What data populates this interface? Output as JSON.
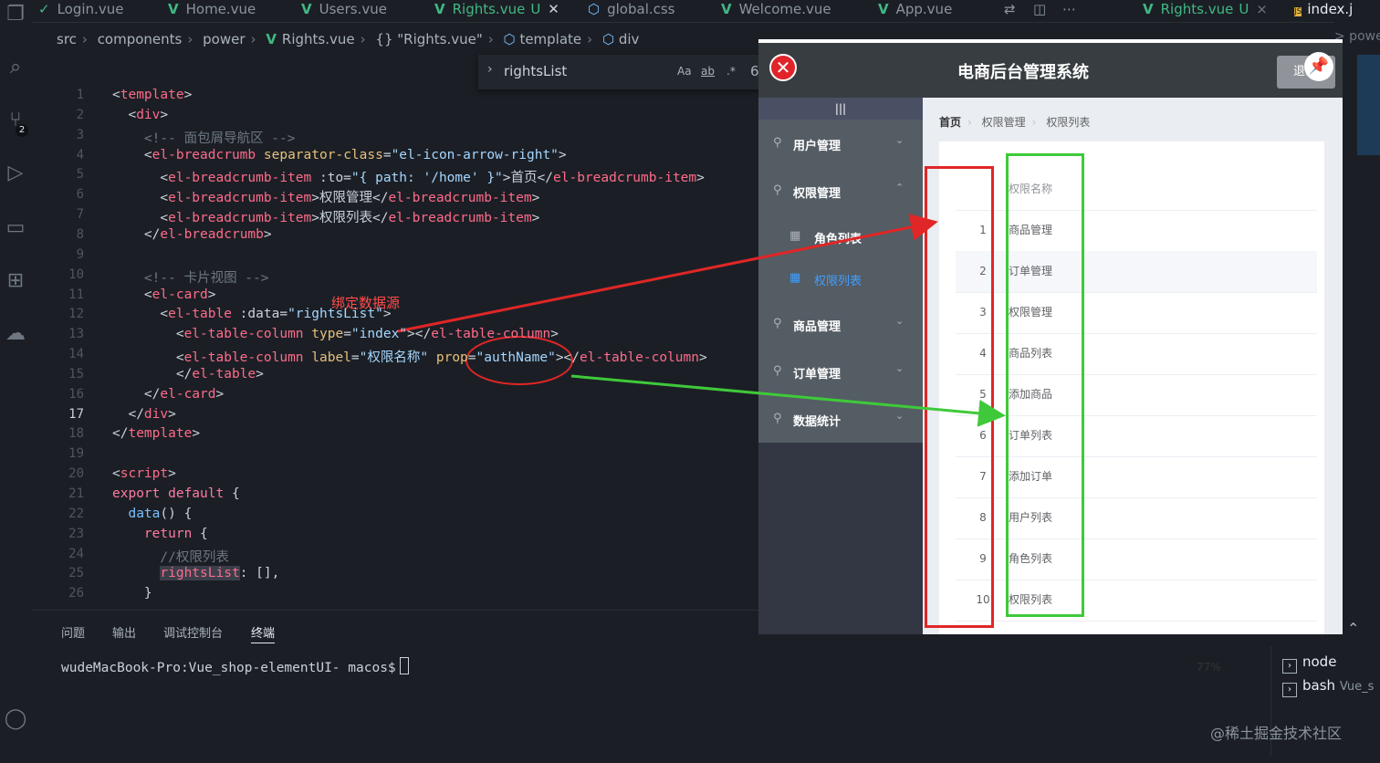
{
  "tabs": [
    {
      "label": "Login.vue",
      "active": false
    },
    {
      "label": "Home.vue",
      "active": false
    },
    {
      "label": "Users.vue",
      "active": false
    },
    {
      "label": "Rights.vue",
      "status": "U",
      "active": true
    },
    {
      "label": "global.css",
      "active": false
    },
    {
      "label": "Welcome.vue",
      "active": false
    },
    {
      "label": "App.vue",
      "active": false
    }
  ],
  "right_tabs": [
    {
      "label": "Rights.vue",
      "status": "U"
    },
    {
      "label": "index.j"
    }
  ],
  "right_edge_text": ">  power  >  Rights.vue  >  {} \"Rights.vu",
  "right_tab_icons": {
    "index_badge": "JS",
    "close": "×"
  },
  "breadcrumb": [
    "src",
    "components",
    "power",
    "Rights.vue",
    "{} \"Rights.vue\"",
    "template",
    "div"
  ],
  "find": {
    "term": "rightsList",
    "opt_case": "Aa",
    "opt_word": "ab",
    "opt_regex": ".*",
    "count": "6"
  },
  "activity": {
    "scm_badge": "2"
  },
  "editor": {
    "current_line": 17,
    "lines": [
      [
        "<template>"
      ],
      [
        "  <div>"
      ],
      [
        "    <!-- 面包屑导航区 -->"
      ],
      [
        "    <el-breadcrumb separator-class=\"el-icon-arrow-right\">"
      ],
      [
        "      <el-breadcrumb-item :to=\"{ path: '/home' }\">首页</el-breadcrumb-item>"
      ],
      [
        "      <el-breadcrumb-item>权限管理</el-breadcrumb-item>"
      ],
      [
        "      <el-breadcrumb-item>权限列表</el-breadcrumb-item>"
      ],
      [
        "    </el-breadcrumb>"
      ],
      [
        ""
      ],
      [
        "    <!-- 卡片视图 -->"
      ],
      [
        "    <el-card>"
      ],
      [
        "      <el-table :data=\"rightsList\">"
      ],
      [
        "        <el-table-column type=\"index\"></el-table-column>"
      ],
      [
        "        <el-table-column label=\"权限名称\" prop=\"authName\"></el-table-column>"
      ],
      [
        "        </el-table>"
      ],
      [
        "    </el-card>"
      ],
      [
        "  </div>"
      ],
      [
        "</template>"
      ],
      [
        ""
      ],
      [
        "<script>"
      ],
      [
        "export default {"
      ],
      [
        "  data() {"
      ],
      [
        "    return {"
      ],
      [
        "      //权限列表"
      ],
      [
        "      rightsList: [],"
      ],
      [
        "    }"
      ]
    ],
    "annotation": "绑定数据源"
  },
  "panel": {
    "tabs": [
      "问题",
      "输出",
      "调试控制台",
      "终端"
    ],
    "active_tab": "终端",
    "prompt": "wudeMacBook-Pro:Vue_shop-elementUI- macos$",
    "terminals": [
      "node",
      "bash"
    ],
    "terminal_suffix": "Vue_s"
  },
  "watermark": "@稀土掘金技术社区",
  "browser": {
    "app_title": "电商后台管理系统",
    "logout_label": "退出",
    "toggle_label": "|||",
    "menu": [
      {
        "label": "用户管理",
        "type": "group"
      },
      {
        "label": "权限管理",
        "type": "group",
        "open": true
      },
      {
        "label": "角色列表",
        "type": "sub"
      },
      {
        "label": "权限列表",
        "type": "sub",
        "active": true
      },
      {
        "label": "商品管理",
        "type": "group"
      },
      {
        "label": "订单管理",
        "type": "group"
      },
      {
        "label": "数据统计",
        "type": "group"
      }
    ],
    "breadcrumb": [
      "首页",
      "权限管理",
      "权限列表"
    ],
    "table": {
      "header": "权限名称",
      "rows": [
        {
          "index": "1",
          "name": "商品管理"
        },
        {
          "index": "2",
          "name": "订单管理"
        },
        {
          "index": "3",
          "name": "权限管理"
        },
        {
          "index": "4",
          "name": "商品列表"
        },
        {
          "index": "5",
          "name": "添加商品"
        },
        {
          "index": "6",
          "name": "订单列表"
        },
        {
          "index": "7",
          "name": "添加订单"
        },
        {
          "index": "8",
          "name": "用户列表"
        },
        {
          "index": "9",
          "name": "角色列表"
        },
        {
          "index": "10",
          "name": "权限列表"
        }
      ]
    },
    "zoom": "77%"
  },
  "colors": {
    "vue_green": "#41b883",
    "annotation_red": "#e02626",
    "annotation_green": "#3fc93a",
    "active_menu": "#409eff"
  }
}
